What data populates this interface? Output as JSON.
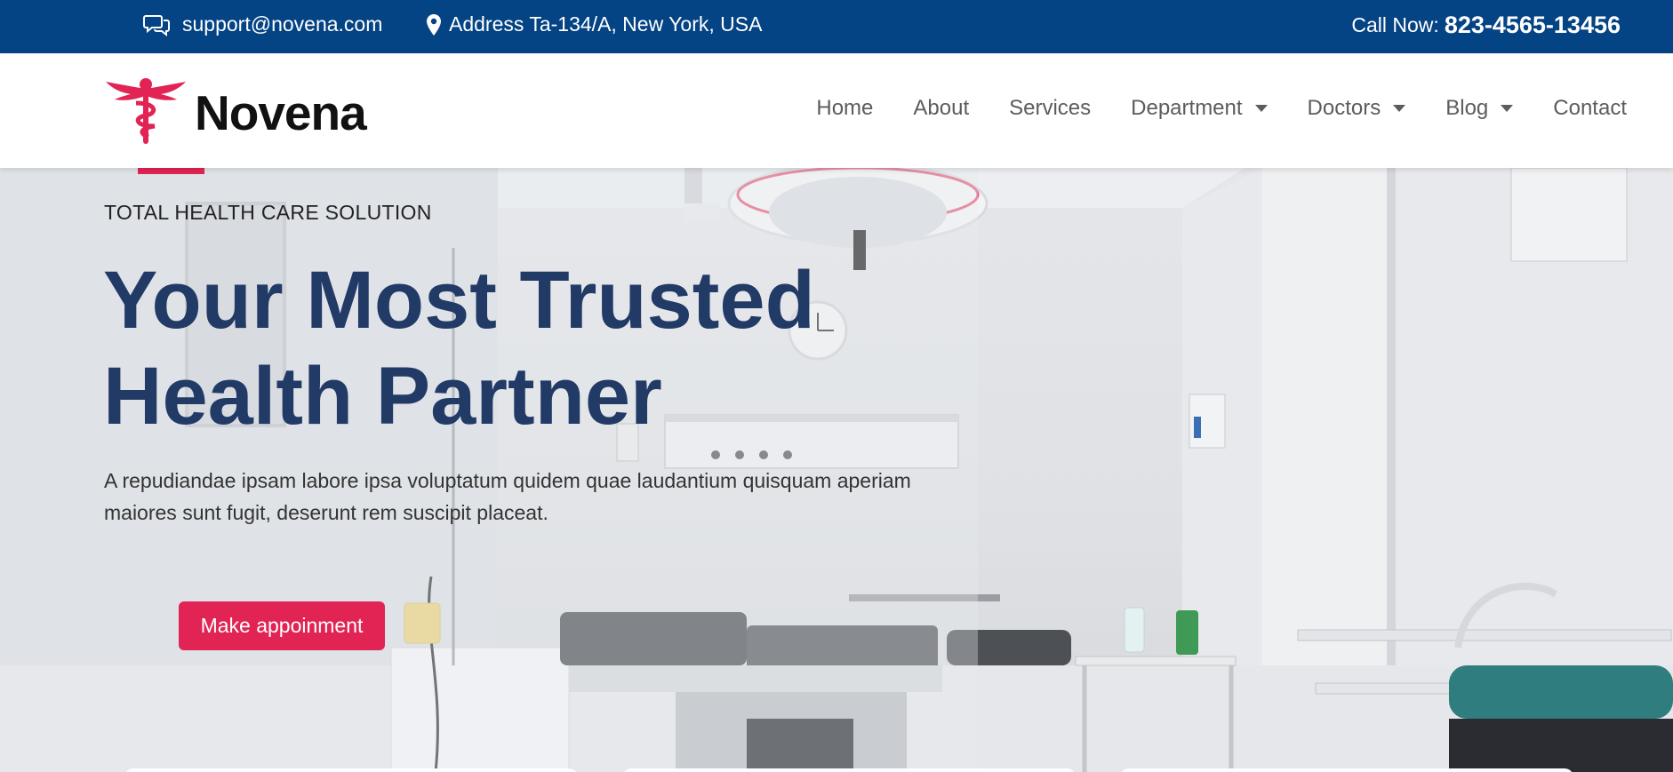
{
  "topbar": {
    "email": "support@novena.com",
    "address": "Address Ta-134/A, New York, USA",
    "call_label": "Call Now:",
    "phone": "823-4565-13456"
  },
  "brand": {
    "name": "Novena",
    "logo_icon": "caduceus-icon"
  },
  "nav": {
    "items": [
      {
        "label": "Home",
        "dropdown": false
      },
      {
        "label": "About",
        "dropdown": false
      },
      {
        "label": "Services",
        "dropdown": false
      },
      {
        "label": "Department",
        "dropdown": true
      },
      {
        "label": "Doctors",
        "dropdown": true
      },
      {
        "label": "Blog",
        "dropdown": true
      },
      {
        "label": "Contact",
        "dropdown": false
      }
    ]
  },
  "hero": {
    "eyebrow": "TOTAL HEALTH CARE SOLUTION",
    "title_line1": "Your Most Trusted",
    "title_line2": "Health Partner",
    "lead_line1": "A repudiandae ipsam labore ipsa voluptatum quidem quae laudantium quisquam aperiam",
    "lead_line2": "maiores sunt fugit, deserunt rem suscipit placeat.",
    "cta": "Make appoinment"
  },
  "colors": {
    "topbar": "#044384",
    "accent": "#e12454",
    "heading": "#223a66"
  }
}
